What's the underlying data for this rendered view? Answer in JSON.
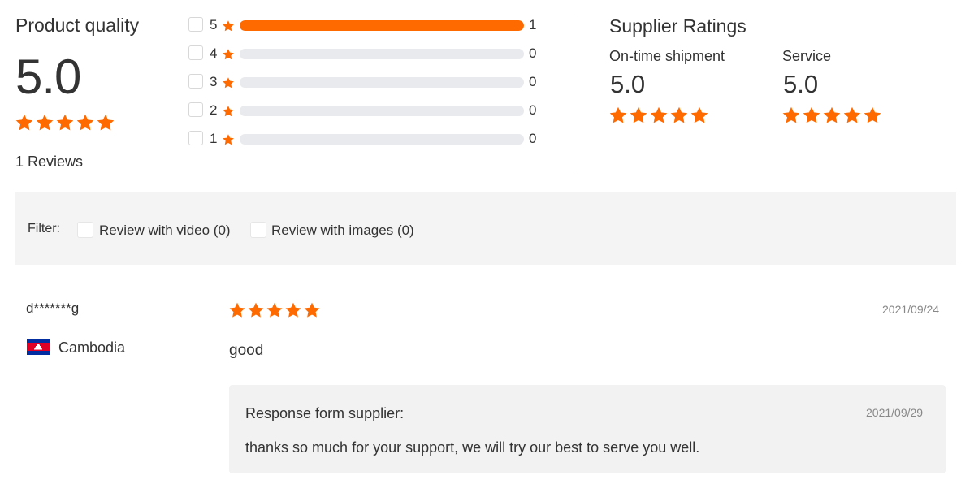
{
  "product_quality": {
    "title": "Product quality",
    "score": "5.0",
    "stars": 5,
    "reviews_text": "1 Reviews"
  },
  "breakdown": [
    {
      "stars": "5",
      "count": "1",
      "fraction": 1.0
    },
    {
      "stars": "4",
      "count": "0",
      "fraction": 0
    },
    {
      "stars": "3",
      "count": "0",
      "fraction": 0
    },
    {
      "stars": "2",
      "count": "0",
      "fraction": 0
    },
    {
      "stars": "1",
      "count": "0",
      "fraction": 0
    }
  ],
  "supplier_ratings": {
    "title": "Supplier Ratings",
    "items": [
      {
        "label": "On-time shipment",
        "score": "5.0",
        "stars": 5
      },
      {
        "label": "Service",
        "score": "5.0",
        "stars": 5
      }
    ]
  },
  "filter": {
    "label": "Filter:",
    "options": [
      {
        "label": "Review with video (0)",
        "checked": false
      },
      {
        "label": "Review with images (0)",
        "checked": false
      }
    ]
  },
  "review": {
    "user": "d*******g",
    "country": "Cambodia",
    "flag_icon": "cambodia-flag-icon",
    "stars": 5,
    "date": "2021/09/24",
    "text": "good",
    "response": {
      "title": "Response form supplier:",
      "date": "2021/09/29",
      "text": "thanks so much for your support, we will try our best to serve you well."
    }
  },
  "colors": {
    "accent": "#ff6a00",
    "track": "#e9eaee",
    "panel": "#f4f4f4"
  }
}
